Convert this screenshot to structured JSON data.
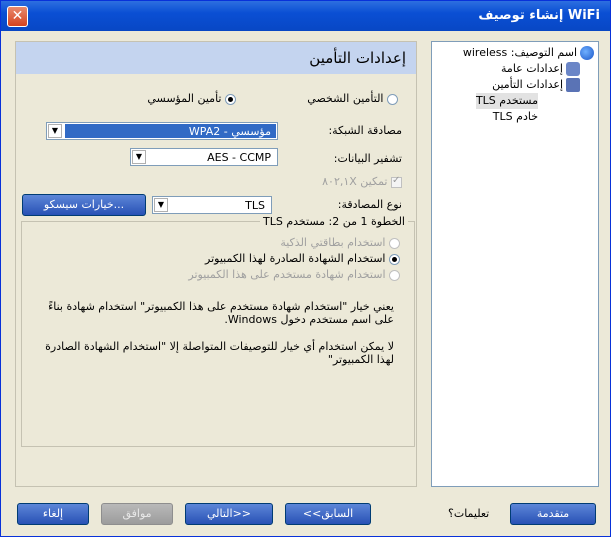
{
  "titlebar": {
    "title": "إنشاء توصيف WiFi",
    "close": "✕"
  },
  "tree": {
    "items": [
      {
        "label": "اسم التوصيف: wireless",
        "icon": "globe-icon"
      },
      {
        "label": "إعدادات عامة",
        "icon": "users-icon"
      },
      {
        "label": "إعدادات التأمين",
        "icon": "lock-icon"
      },
      {
        "label": "مستخدم TLS"
      },
      {
        "label": "خادم TLS"
      }
    ]
  },
  "main": {
    "header": "إعدادات التأمين",
    "personal_security": "التأمين الشخصي",
    "enterprise_security": "تأمين المؤسسي",
    "network_auth_label": "مصادقة الشبكة:",
    "network_auth_value": "WPA2 - مؤسسي",
    "data_encryption_label": "تشفير البيانات:",
    "data_encryption_value": "AES - CCMP",
    "enable_8021x": "تمكين ٨٠٢,١X",
    "auth_type_label": "نوع المصادقة:",
    "auth_type_value": "TLS",
    "cisco_options": "خيارات سيسكو..."
  },
  "group": {
    "title": "الخطوة 1 من 2: مستخدم TLS",
    "opt_smartcard": "استخدام بطاقتي الذكية",
    "opt_issued_cert": "استخدام الشهادة الصادرة لهذا الكمبيوتر",
    "opt_user_cert": "استخدام شهادة مستخدم على هذا الكمبيوتر",
    "para1": "يعني خيار \"استخدام شهادة مستخدم على هذا الكمبيوتر\" استخدام شهادة بناءً على اسم مستخدم دخول Windows.",
    "para2": "لا يمكن استخدام أي خيار للتوصيفات المتواصلة إلا \"استخدام الشهادة الصادرة لهذا الكمبيوتر\""
  },
  "buttons": {
    "cancel": "إلغاء",
    "ok": "موافق",
    "next": "التالي>>",
    "back": "<<السابق",
    "help": "تعليمات؟",
    "advanced": "متقدمة"
  },
  "colors": {
    "accent": "#316ac5",
    "header_band": "#c4d4ef",
    "button": "#2851b5"
  }
}
